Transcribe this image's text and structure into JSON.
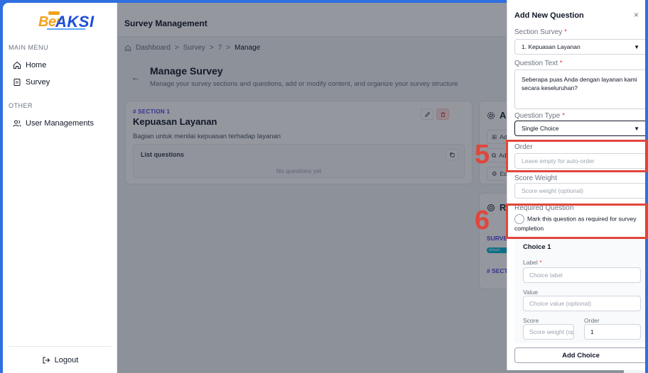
{
  "brand": {
    "ber": "Ber",
    "aksi": "AKSI"
  },
  "sidebar": {
    "main_menu_label": "MAIN MENU",
    "items": [
      {
        "label": "Home",
        "icon": "home-icon"
      },
      {
        "label": "Survey",
        "icon": "document-icon"
      }
    ],
    "other_label": "OTHER",
    "other_items": [
      {
        "label": "User Managements",
        "icon": "users-icon"
      }
    ],
    "logout_label": "Logout"
  },
  "topbar": {
    "title": "Survey Management"
  },
  "breadcrumb": {
    "items": [
      "Dashboard",
      "Survey",
      "7",
      "Manage"
    ],
    "separator": ">"
  },
  "page": {
    "title": "Manage Survey",
    "subtitle": "Manage your survey sections and questions, add or modify content, and organize your survey structure"
  },
  "section": {
    "tag": "# SECTION 1",
    "title": "Kepuasan Layanan",
    "description": "Bagian untuk menilai kepuasan terhadap layanan",
    "list_title": "List questions",
    "empty_text": "No questions yet"
  },
  "actions_card": {
    "title": "Act",
    "buttons": [
      "Add",
      "Ad",
      "Ed"
    ]
  },
  "results_card": {
    "title": "Re",
    "survey_label": "SURVE",
    "pill": "default",
    "section_label": "# SECT"
  },
  "drawer": {
    "title": "Add New Question",
    "close": "×",
    "section_label": "Section Survey",
    "section_value": "1. Kepuasan Layanan",
    "question_label": "Question Text",
    "question_value": "Seberapa puas Anda dengan layanan kami secara keseluruhan?",
    "type_label": "Question Type",
    "type_value": "Single Choice",
    "order_label": "Order",
    "order_placeholder": "Leave empty for auto-order",
    "weight_label": "Score Weight",
    "weight_placeholder": "Score weight (optional)",
    "required_label": "Required Question",
    "required_text": "Mark this question as required for survey completion",
    "required_mark": "*",
    "choice": {
      "title": "Choice 1",
      "label_label": "Label",
      "label_placeholder": "Choice label",
      "value_label": "Value",
      "value_placeholder": "Choice value (optional)",
      "score_label": "Score",
      "score_placeholder": "Score weight (optional)",
      "order_label": "Order",
      "order_value": "1"
    },
    "add_choice_label": "Add Choice"
  },
  "annotations": {
    "step5": "5",
    "step6": "6",
    "color": "#e0463b"
  },
  "colors": {
    "accent": "#4f46e5",
    "brand_blue": "#1d4ed8",
    "brand_orange": "#f2a21b",
    "danger": "#dc2626"
  }
}
